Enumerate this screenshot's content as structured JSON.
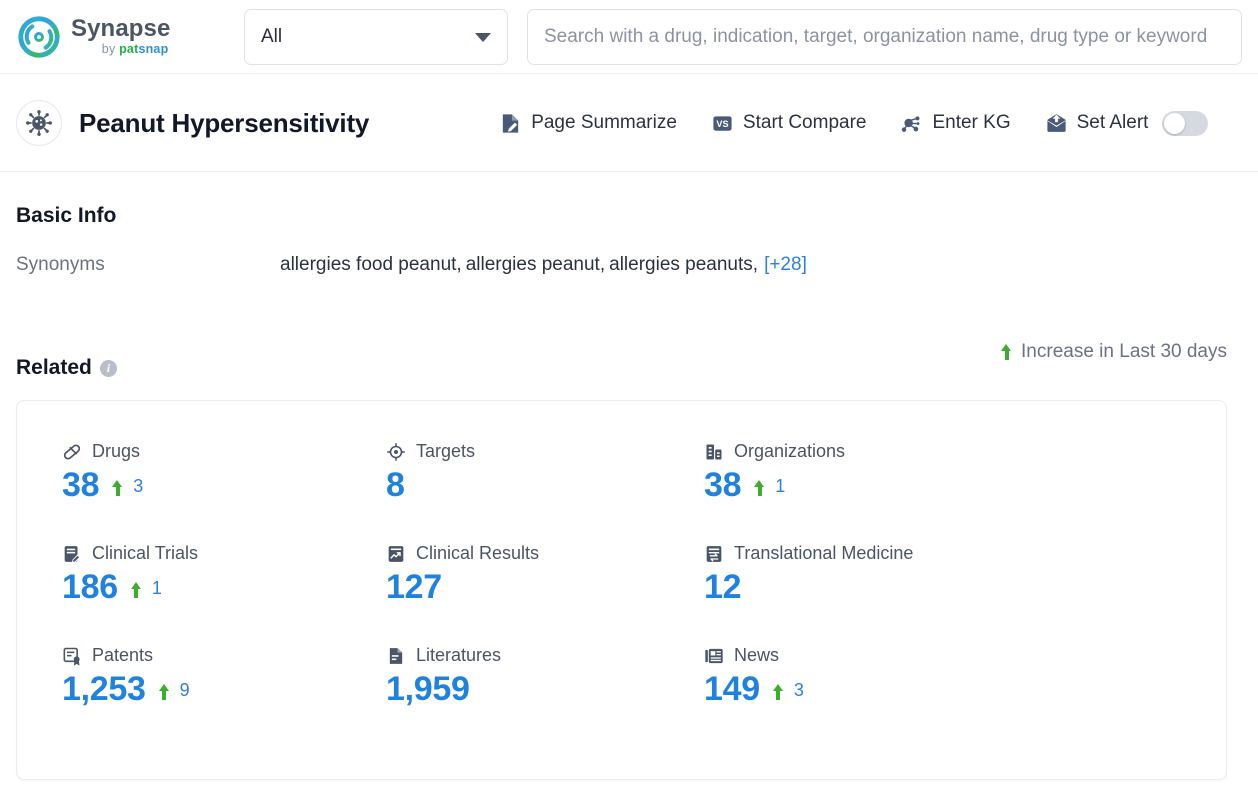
{
  "brand": {
    "name": "Synapse",
    "by": "by ",
    "pat": "pat",
    "snap": "snap",
    "logo_icon": "synapse-circular-logo",
    "colors": {
      "green": "#22b14c",
      "blue": "#2f8fe0"
    }
  },
  "search": {
    "scope_value": "All",
    "scope_caret_icon": "chevron-down-icon",
    "placeholder": "Search with a drug, indication, target, organization name, drug type or keyword",
    "value": ""
  },
  "header": {
    "entity_icon": "virus-icon",
    "title": "Peanut Hypersensitivity",
    "actions": [
      {
        "label": "Page Summarize",
        "icon": "page-summarize-icon"
      },
      {
        "label": "Start Compare",
        "icon": "vs-badge-icon"
      },
      {
        "label": "Enter KG",
        "icon": "knowledge-graph-icon"
      },
      {
        "label": "Set Alert",
        "icon": "alert-envelope-icon"
      }
    ],
    "alert_toggle_state": "off"
  },
  "basic_info": {
    "title": "Basic Info",
    "synonyms_label": "Synonyms",
    "synonyms": [
      "allergies food peanut,",
      "allergies peanut,",
      "allergies peanuts,"
    ],
    "synonyms_more": "[+28]"
  },
  "related": {
    "title": "Related",
    "info_icon": "info-icon",
    "legend_icon": "arrow-up-icon",
    "legend_text": "Increase in Last 30 days",
    "accent_blue": "#1f82e0",
    "increase_green": "#3cae2b",
    "stats": [
      {
        "name": "Drugs",
        "icon": "pill-icon",
        "value": "38",
        "delta": "3"
      },
      {
        "name": "Targets",
        "icon": "target-crosshair-icon",
        "value": "8",
        "delta": ""
      },
      {
        "name": "Organizations",
        "icon": "building-icon",
        "value": "38",
        "delta": "1"
      },
      {
        "name": "Clinical Trials",
        "icon": "clinical-trial-icon",
        "value": "186",
        "delta": "1"
      },
      {
        "name": "Clinical Results",
        "icon": "clinical-results-icon",
        "value": "127",
        "delta": ""
      },
      {
        "name": "Translational Medicine",
        "icon": "translational-icon",
        "value": "12",
        "delta": ""
      },
      {
        "name": "Patents",
        "icon": "patent-icon",
        "value": "1,253",
        "delta": "9"
      },
      {
        "name": "Literatures",
        "icon": "literature-doc-icon",
        "value": "1,959",
        "delta": ""
      },
      {
        "name": "News",
        "icon": "news-icon",
        "value": "149",
        "delta": "3"
      }
    ]
  }
}
